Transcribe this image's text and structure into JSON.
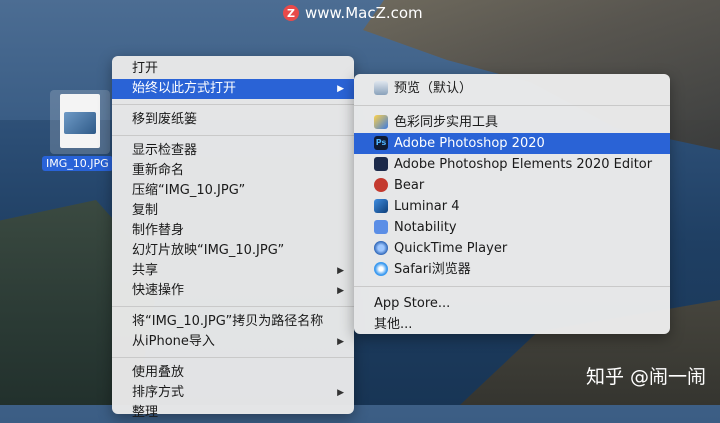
{
  "watermark": {
    "logo": "Z",
    "text": "www.MacZ.com"
  },
  "credit": "知乎 @闹一闹",
  "desktop": {
    "file_label": "IMG_10.JPG"
  },
  "context_menu": {
    "items": [
      {
        "label": "打开"
      },
      {
        "label": "始终以此方式打开",
        "submenu": true,
        "selected": true
      },
      {
        "label": "移到废纸篓"
      },
      {
        "label": "显示检查器"
      },
      {
        "label": "重新命名"
      },
      {
        "label": "压缩“IMG_10.JPG”"
      },
      {
        "label": "复制"
      },
      {
        "label": "制作替身"
      },
      {
        "label": "幻灯片放映“IMG_10.JPG”"
      },
      {
        "label": "共享",
        "submenu": true
      },
      {
        "label": "快速操作",
        "submenu": true
      },
      {
        "label": "将“IMG_10.JPG”拷贝为路径名称"
      },
      {
        "label": "从iPhone导入",
        "submenu": true
      },
      {
        "label": "使用叠放"
      },
      {
        "label": "排序方式",
        "submenu": true
      },
      {
        "label": "整理"
      }
    ],
    "arrow": "▶"
  },
  "submenu": {
    "items": [
      {
        "label": "预览（默认）",
        "icon": "preview-icon"
      },
      {
        "label": "色彩同步实用工具",
        "icon": "colorsync-icon"
      },
      {
        "label": "Adobe Photoshop 2020",
        "icon": "photoshop-icon",
        "selected": true
      },
      {
        "label": "Adobe Photoshop Elements 2020 Editor",
        "icon": "photoshop-elements-icon"
      },
      {
        "label": "Bear",
        "icon": "bear-icon"
      },
      {
        "label": "Luminar 4",
        "icon": "luminar-icon"
      },
      {
        "label": "Notability",
        "icon": "notability-icon"
      },
      {
        "label": "QuickTime Player",
        "icon": "quicktime-icon"
      },
      {
        "label": "Safari浏览器",
        "icon": "safari-icon"
      },
      {
        "label": "App Store..."
      },
      {
        "label": "其他..."
      }
    ],
    "ps_icon_text": "Ps"
  }
}
